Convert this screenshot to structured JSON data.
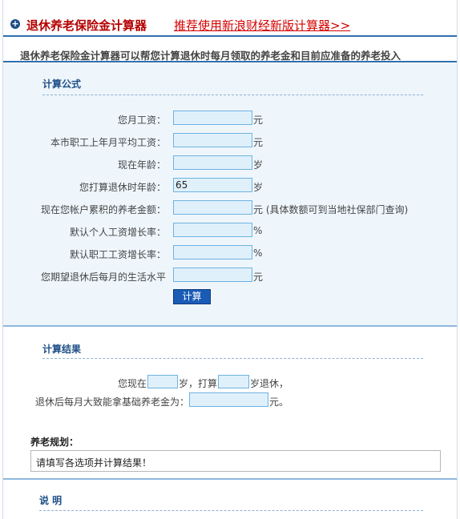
{
  "header": {
    "icon": "plus-circle-icon",
    "title": "退休养老保险金计算器",
    "promo_link": "推荐使用新浪财经新版计算器>>"
  },
  "subtitle": "退休养老保险金计算器可以帮您计算退休时每月领取的养老金和目前应准备的养老投入",
  "formula": {
    "heading": "计算公式",
    "rows": [
      {
        "label": "您月工资：",
        "value": "",
        "unit": "元"
      },
      {
        "label": "本市职工上年月平均工资：",
        "value": "",
        "unit": "元"
      },
      {
        "label": "现在年龄：",
        "value": "",
        "unit": "岁"
      },
      {
        "label": "您打算退休时年龄：",
        "value": "65",
        "unit": "岁"
      },
      {
        "label": "现在您帐户累积的养老金额：",
        "value": "",
        "unit": "元 (具体数额可到当地社保部门查询)"
      },
      {
        "label": "默认个人工资增长率：",
        "value": "",
        "unit": "%"
      },
      {
        "label": "默认职工工资增长率：",
        "value": "",
        "unit": "%"
      },
      {
        "label": "您期望退休后每月的生活水平",
        "value": "",
        "unit": "元"
      }
    ],
    "button": "计算"
  },
  "result": {
    "heading": "计算结果",
    "line1_a": "您现在",
    "line1_b": "岁，打算",
    "line1_c": "岁退休，",
    "line2_a": "退休后每月大致能拿基础养老金为：",
    "line2_b": "元。"
  },
  "plan": {
    "title": "养老规划：",
    "text": "请填写各选项并计算结果！"
  },
  "notes": {
    "heading": "说 明"
  },
  "colors": {
    "title_red": "#b40000",
    "link_red": "#d40000",
    "heading_blue": "#1e4f86",
    "panel_bg": "#eef6fc",
    "button_blue": "#1a5bb5"
  }
}
